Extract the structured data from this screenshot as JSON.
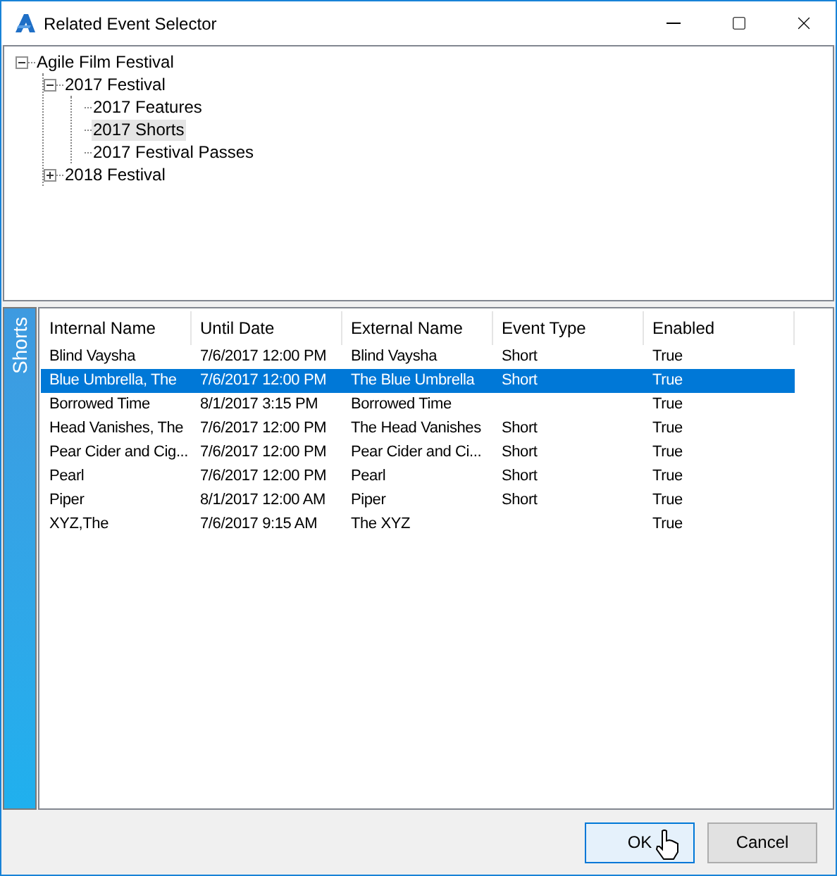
{
  "window": {
    "title": "Related Event Selector"
  },
  "tree": [
    {
      "label": "Agile Film Festival",
      "expanded": true,
      "selected": false,
      "children": [
        {
          "label": "2017 Festival",
          "expanded": true,
          "selected": false,
          "children": [
            {
              "label": "2017 Features",
              "selected": false
            },
            {
              "label": "2017 Shorts",
              "selected": true
            },
            {
              "label": "2017 Festival Passes",
              "selected": false
            }
          ]
        },
        {
          "label": "2018 Festival",
          "expanded": false,
          "selected": false
        }
      ]
    }
  ],
  "side_tab": {
    "label": "Shorts"
  },
  "table": {
    "columns": [
      "Internal Name",
      "Until Date",
      "External Name",
      "Event Type",
      "Enabled"
    ],
    "rows": [
      {
        "cells": [
          "Blind Vaysha",
          "7/6/2017 12:00 PM",
          "Blind Vaysha",
          "Short",
          "True"
        ],
        "selected": false
      },
      {
        "cells": [
          "Blue Umbrella, The",
          "7/6/2017 12:00 PM",
          "The Blue Umbrella",
          "Short",
          "True"
        ],
        "selected": true
      },
      {
        "cells": [
          "Borrowed Time",
          "8/1/2017 3:15 PM",
          "Borrowed Time",
          "",
          "True"
        ],
        "selected": false
      },
      {
        "cells": [
          "Head Vanishes, The",
          "7/6/2017 12:00 PM",
          "The Head Vanishes",
          "Short",
          "True"
        ],
        "selected": false
      },
      {
        "cells": [
          "Pear Cider and Cig...",
          "7/6/2017 12:00 PM",
          "Pear Cider and Ci...",
          "Short",
          "True"
        ],
        "selected": false
      },
      {
        "cells": [
          "Pearl",
          "7/6/2017 12:00 PM",
          "Pearl",
          "Short",
          "True"
        ],
        "selected": false
      },
      {
        "cells": [
          "Piper",
          "8/1/2017 12:00 AM",
          "Piper",
          "Short",
          "True"
        ],
        "selected": false
      },
      {
        "cells": [
          "XYZ,The",
          "7/6/2017 9:15 AM",
          "The XYZ",
          "",
          "True"
        ],
        "selected": false
      }
    ]
  },
  "buttons": [
    {
      "label": "OK",
      "kind": "default"
    },
    {
      "label": "Cancel",
      "kind": "normal"
    }
  ]
}
